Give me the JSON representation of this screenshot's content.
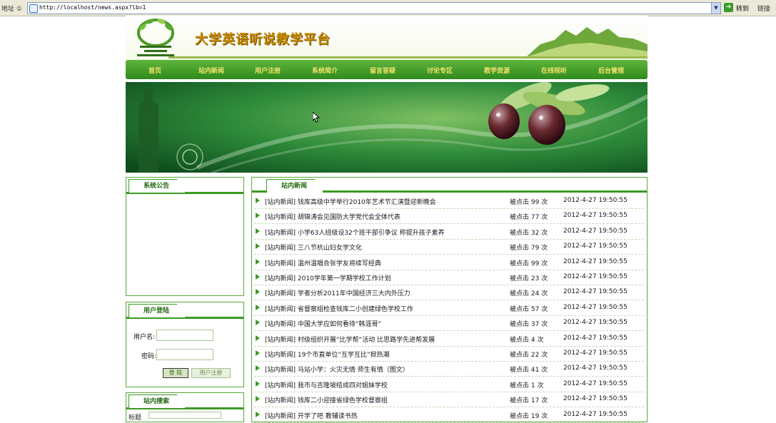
{
  "browser": {
    "address_label": "地址 ①",
    "url": "http://localhost/news.aspx?lb=1",
    "go_label": "转到",
    "links_label": "链接"
  },
  "site": {
    "title": "大学英语听说教学平台"
  },
  "nav": [
    {
      "label": "首页"
    },
    {
      "label": "站内新闻"
    },
    {
      "label": "用户注册"
    },
    {
      "label": "系统简介"
    },
    {
      "label": "留言答疑"
    },
    {
      "label": "讨论专区"
    },
    {
      "label": "教学资源"
    },
    {
      "label": "在线视听"
    },
    {
      "label": "后台管理"
    }
  ],
  "notice": {
    "title": "系统公告"
  },
  "login": {
    "title": "用户登陆",
    "username_label": "用户名:",
    "password_label": "密码:",
    "login_button": "登 陆",
    "register_button": "用户注册"
  },
  "search": {
    "title": "站内搜索",
    "label": "标题"
  },
  "news": {
    "title": "站内新闻",
    "items": [
      {
        "title": "[站内新闻] 钱库高级中学举行2010年艺术节汇演暨迎新晚会",
        "clicks": "被点击 99 次",
        "date": "2012-4-27 19:50:55"
      },
      {
        "title": "[站内新闻] 胡锦涛会见国防大学党代会全体代表",
        "clicks": "被点击 77 次",
        "date": "2012-4-27 19:50:55"
      },
      {
        "title": "[站内新闻] 小学63人班级设32个班干部引争议 称提升孩子素养",
        "clicks": "被点击 32 次",
        "date": "2012-4-27 19:50:55"
      },
      {
        "title": "[站内新闻] 三八节杭山妇女学文化",
        "clicks": "被点击 79 次",
        "date": "2012-4-27 19:50:55"
      },
      {
        "title": "[站内新闻] 温州温唱合张学友将续写经典",
        "clicks": "被点击 99 次",
        "date": "2012-4-27 19:50:55"
      },
      {
        "title": "[站内新闻] 2010学年第一学期学校工作计划",
        "clicks": "被点击 23 次",
        "date": "2012-4-27 19:50:55"
      },
      {
        "title": "[站内新闻] 学者分析2011年中国经济三大内外压力",
        "clicks": "被点击 24 次",
        "date": "2012-4-27 19:50:55"
      },
      {
        "title": "[站内新闻] 省督察组检查钱库二小创建绿色学校工作",
        "clicks": "被点击 57 次",
        "date": "2012-4-27 19:50:55"
      },
      {
        "title": "[站内新闻] 中国大学应如何看待“韩涯哥”",
        "clicks": "被点击 37 次",
        "date": "2012-4-27 19:50:55"
      },
      {
        "title": "[站内新闻] 村级组织开展“比学帮”活动 比思路学先进帮发展",
        "clicks": "被点击 4 次",
        "date": "2012-4-27 19:50:55"
      },
      {
        "title": "[站内新闻] 19个市直单位“互学互比”掀热潮",
        "clicks": "被点击 22 次",
        "date": "2012-4-27 19:50:55"
      },
      {
        "title": "[站内新闻] 马站小学：火灾无情 师生有情（图文）",
        "clicks": "被点击 41 次",
        "date": "2012-4-27 19:50:55"
      },
      {
        "title": "[站内新闻] 我市与吉隆坡结成四对姐妹学校",
        "clicks": "被点击 1 次",
        "date": "2012-4-27 19:50:55"
      },
      {
        "title": "[站内新闻] 钱库二小迎接省绿色学校督察组",
        "clicks": "被点击 17 次",
        "date": "2012-4-27 19:50:55"
      },
      {
        "title": "[站内新闻] 开学了吧 教辅读书热",
        "clicks": "被点击 19 次",
        "date": "2012-4-27 19:50:55"
      }
    ]
  }
}
